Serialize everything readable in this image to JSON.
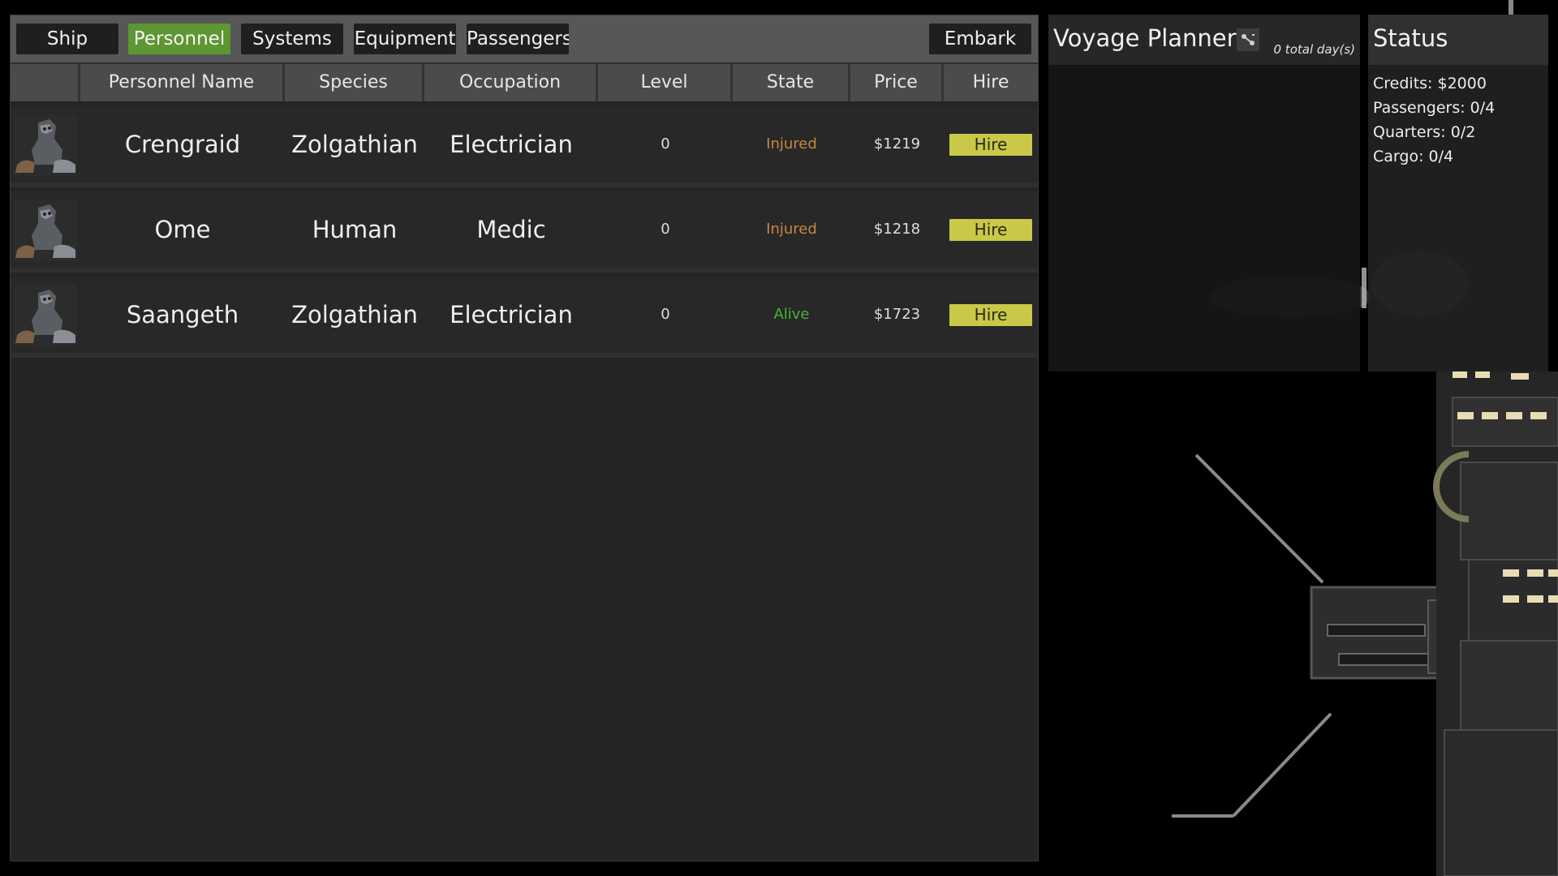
{
  "tabs": [
    {
      "label": "Ship",
      "active": false
    },
    {
      "label": "Personnel",
      "active": true
    },
    {
      "label": "Systems",
      "active": false
    },
    {
      "label": "Equipment",
      "active": false
    },
    {
      "label": "Passengers",
      "active": false
    }
  ],
  "embark_label": "Embark",
  "table": {
    "headers": [
      "",
      "Personnel Name",
      "Species",
      "Occupation",
      "Level",
      "State",
      "Price",
      "Hire"
    ],
    "rows": [
      {
        "name": "Crengraid",
        "species": "Zolgathian",
        "occupation": "Electrician",
        "level": "0",
        "state": "Injured",
        "price": "$1219",
        "hire": "Hire"
      },
      {
        "name": "Ome",
        "species": "Human",
        "occupation": "Medic",
        "level": "0",
        "state": "Injured",
        "price": "$1218",
        "hire": "Hire"
      },
      {
        "name": "Saangeth",
        "species": "Zolgathian",
        "occupation": "Electrician",
        "level": "0",
        "state": "Alive",
        "price": "$1723",
        "hire": "Hire"
      }
    ]
  },
  "voyage": {
    "title": "Voyage Planner",
    "days": "0 total day(s)",
    "settings_icon": "route-icon"
  },
  "status": {
    "title": "Status",
    "lines": [
      "Credits: $2000",
      "Passengers: 0/4",
      "Quarters: 0/2",
      "Cargo: 0/4"
    ]
  },
  "colors": {
    "active_tab": "#5d9632",
    "hire_button": "#c9c848",
    "injured": "#c8873f",
    "alive": "#46b43a"
  }
}
